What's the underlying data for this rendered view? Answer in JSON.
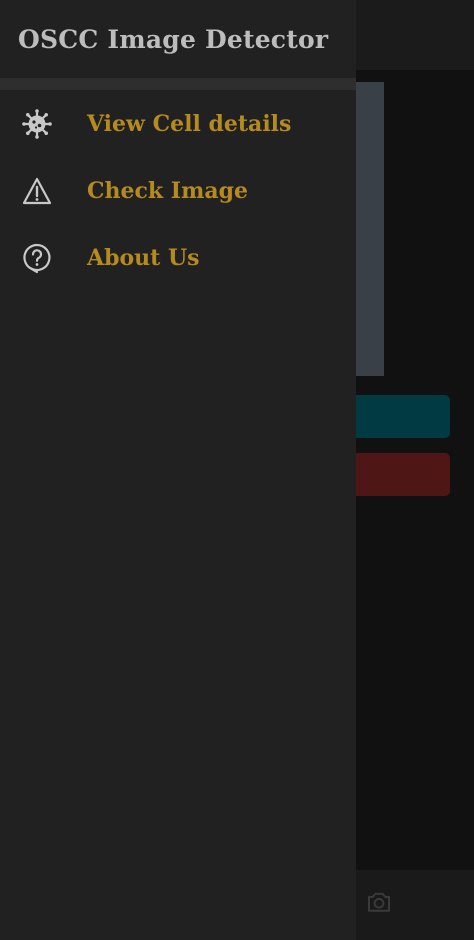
{
  "drawer": {
    "title": "OSCC Image Detector",
    "items": [
      {
        "label": "View Cell details",
        "icon": "virus-icon"
      },
      {
        "label": "Check Image",
        "icon": "warning-triangle-icon"
      },
      {
        "label": "About Us",
        "icon": "help-bubble-icon"
      }
    ]
  },
  "background": {
    "bottom_bar_icon": "camera-icon"
  },
  "colors": {
    "drawer_bg": "#212121",
    "title_text": "#bdbdbd",
    "menu_text": "#b58a1e",
    "icon": "#c8c8c8",
    "teal_button": "#013a43",
    "red_button": "#4e1716"
  }
}
